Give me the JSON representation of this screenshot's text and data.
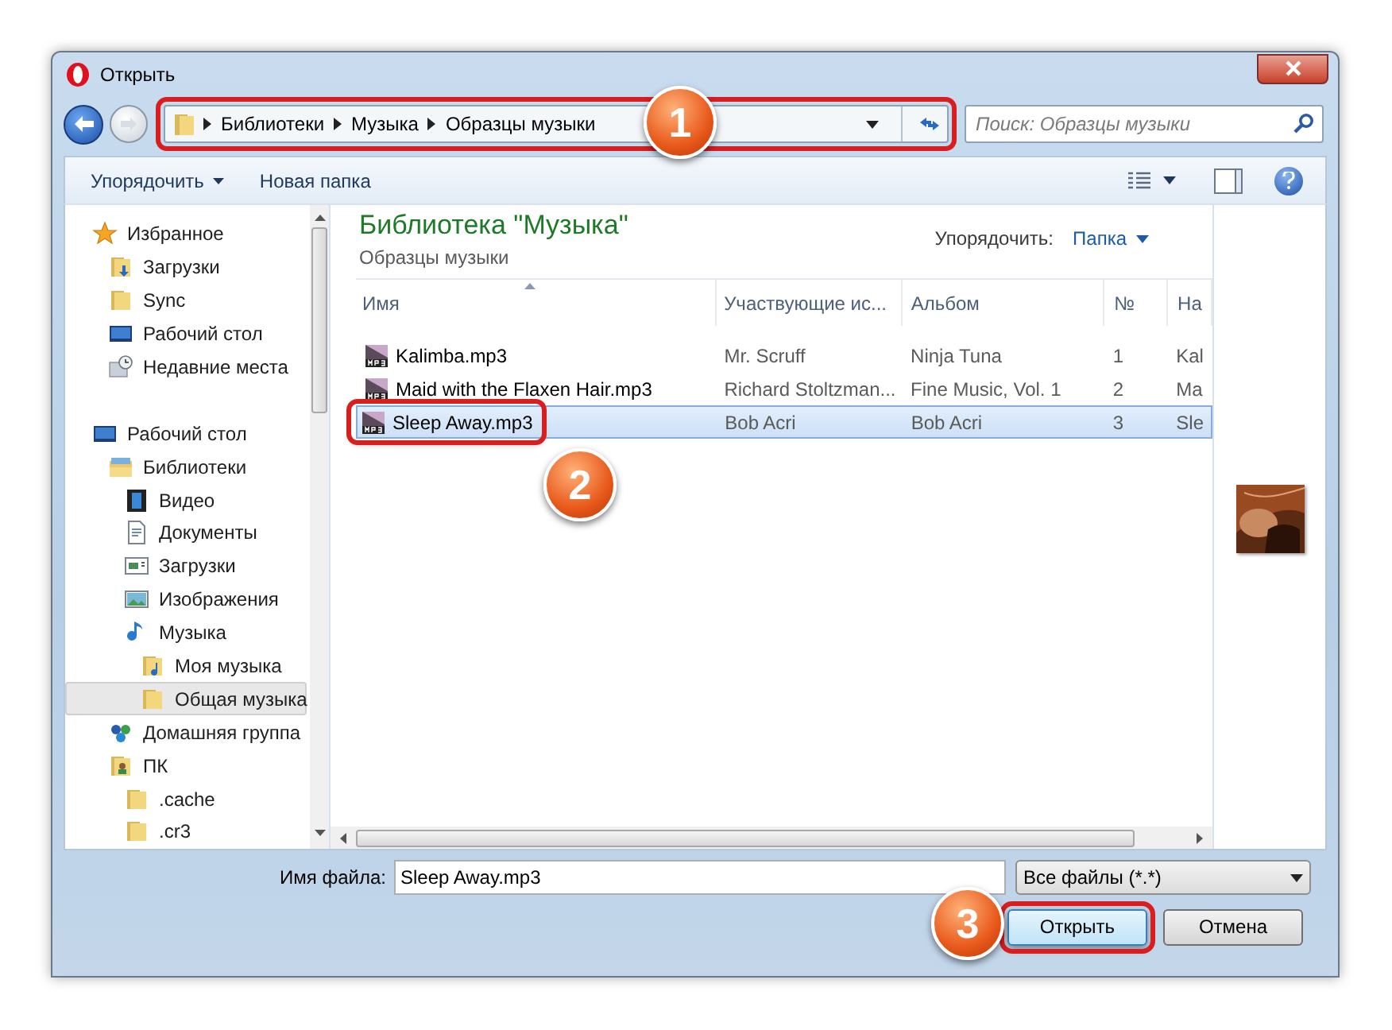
{
  "window": {
    "title": "Открыть"
  },
  "address": {
    "crumbs": [
      "Библиотеки",
      "Музыка",
      "Образцы музыки"
    ],
    "highlighted": true,
    "callout": "1"
  },
  "search": {
    "placeholder": "Поиск: Образцы музыки"
  },
  "toolbar": {
    "organize": "Упорядочить",
    "new_folder": "Новая папка"
  },
  "nav": [
    {
      "label": "Избранное",
      "selected": false,
      "children": [
        {
          "label": "Загрузки",
          "selected": false
        },
        {
          "label": "Sync",
          "selected": false
        },
        {
          "label": "Рабочий стол",
          "selected": false
        },
        {
          "label": "Недавние места",
          "selected": false
        }
      ]
    },
    {
      "label": "Рабочий стол",
      "selected": false,
      "children": [
        {
          "label": "Библиотеки",
          "selected": false,
          "children": [
            {
              "label": "Видео",
              "selected": false
            },
            {
              "label": "Документы",
              "selected": false
            },
            {
              "label": "Загрузки",
              "selected": false
            },
            {
              "label": "Изображения",
              "selected": false
            },
            {
              "label": "Музыка",
              "selected": false,
              "children": [
                {
                  "label": "Моя музыка",
                  "selected": false
                },
                {
                  "label": "Общая музыка",
                  "selected": true
                }
              ]
            }
          ]
        },
        {
          "label": "Домашняя группа",
          "selected": false
        },
        {
          "label": "ПК",
          "selected": false,
          "children": [
            {
              "label": ".cache",
              "selected": false
            },
            {
              "label": ".cr3",
              "selected": false
            }
          ]
        }
      ]
    }
  ],
  "library": {
    "title": "Библиотека \"Музыка\"",
    "subtitle": "Образцы музыки",
    "arrange_label": "Упорядочить:",
    "arrange_value": "Папка"
  },
  "table": {
    "columns": [
      "Имя",
      "Участвующие ис...",
      "Альбом",
      "№",
      "На"
    ],
    "rows": [
      {
        "cells": [
          "Kalimba.mp3",
          "Mr. Scruff",
          "Ninja Tuna",
          "1",
          "Kal"
        ],
        "selected": false,
        "highlighted": false
      },
      {
        "cells": [
          "Maid with the Flaxen Hair.mp3",
          "Richard Stoltzman...",
          "Fine Music, Vol. 1",
          "2",
          "Ma"
        ],
        "selected": false,
        "highlighted": false
      },
      {
        "cells": [
          "Sleep Away.mp3",
          "Bob Acri",
          "Bob Acri",
          "3",
          "Sle"
        ],
        "selected": true,
        "highlighted": true,
        "callout": "2"
      }
    ]
  },
  "filename": {
    "label": "Имя файла:",
    "value": "Sleep Away.mp3"
  },
  "filter": {
    "value": "Все файлы (*.*)"
  },
  "buttons": [
    {
      "label": "Открыть",
      "kind": "primary",
      "highlighted": true,
      "callout": "3"
    },
    {
      "label": "Отмена",
      "kind": "secondary",
      "highlighted": false
    }
  ]
}
